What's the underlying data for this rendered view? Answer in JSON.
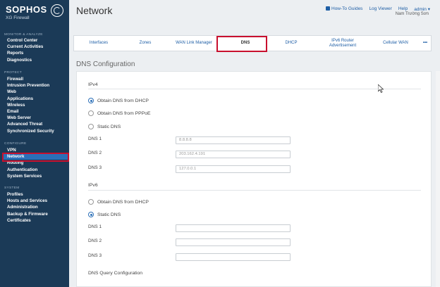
{
  "brand": {
    "name": "SOPHOS",
    "product": "XG Firewall"
  },
  "sidebar": {
    "sections": [
      {
        "title": "MONITOR & ANALYZE",
        "items": [
          "Control Center",
          "Current Activities",
          "Reports",
          "Diagnostics"
        ]
      },
      {
        "title": "PROTECT",
        "items": [
          "Firewall",
          "Intrusion Prevention",
          "Web",
          "Applications",
          "Wireless",
          "Email",
          "Web Server",
          "Advanced Threat",
          "Synchronized Security"
        ]
      },
      {
        "title": "CONFIGURE",
        "items": [
          "VPN",
          "Network",
          "Routing",
          "Authentication",
          "System Services"
        ]
      },
      {
        "title": "SYSTEM",
        "items": [
          "Profiles",
          "Hosts and Services",
          "Administration",
          "Backup & Firmware",
          "Certificates"
        ]
      }
    ],
    "active_item": "Network"
  },
  "header": {
    "title": "Network",
    "links": {
      "how_to": "How-To Guides",
      "log_viewer": "Log Viewer",
      "help": "Help",
      "admin": "admin ▾"
    },
    "user": "Nam Trường Sơn"
  },
  "tabs": {
    "interfaces": "Interfaces",
    "zones": "Zones",
    "wan_link": "WAN Link Manager",
    "dns": "DNS",
    "dhcp": "DHCP",
    "ipv6_line1": "IPv6 Router",
    "ipv6_line2": "Advertisement",
    "cellular": "Cellular WAN",
    "more": "•••"
  },
  "dns": {
    "section_title": "DNS Configuration",
    "ipv4": {
      "heading": "IPv4",
      "options": [
        "Obtain DNS from DHCP",
        "Obtain DNS from PPPoE",
        "Static DNS"
      ],
      "selected": 0,
      "labels": [
        "DNS 1",
        "DNS 2",
        "DNS 3"
      ],
      "values": [
        "8.8.8.8",
        "203.162.4.191",
        "127.0.0.1"
      ]
    },
    "ipv6": {
      "heading": "IPv6",
      "options": [
        "Obtain DNS from DHCP",
        "Static DNS"
      ],
      "selected": 1,
      "labels": [
        "DNS 1",
        "DNS 2",
        "DNS 3"
      ],
      "values": [
        "",
        "",
        ""
      ]
    },
    "query_config": "DNS Query Configuration"
  },
  "colors": {
    "sidebar_bg": "#1b3a57",
    "accent": "#2b6fb8",
    "highlight": "#c8102e",
    "link": "#1f5fa6"
  }
}
